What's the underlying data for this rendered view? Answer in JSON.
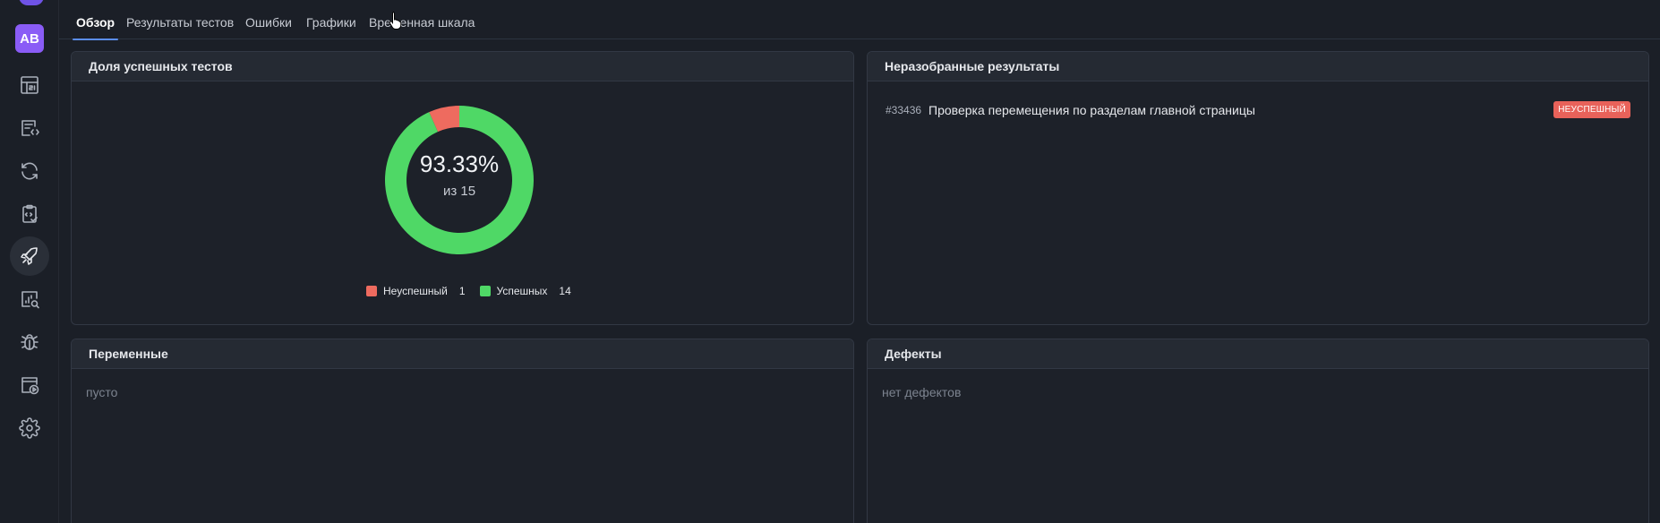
{
  "user": {
    "initials": "AB"
  },
  "sidebar": {
    "items": [
      {
        "icon": "dashboard-icon"
      },
      {
        "icon": "test-cases-icon"
      },
      {
        "icon": "sync-icon"
      },
      {
        "icon": "checklist-icon"
      },
      {
        "icon": "rocket-icon",
        "active": true
      },
      {
        "icon": "analytics-search-icon"
      },
      {
        "icon": "bug-icon"
      },
      {
        "icon": "play-icon"
      },
      {
        "icon": "gear-icon"
      }
    ]
  },
  "tabs": [
    {
      "label": "Обзор",
      "active": true
    },
    {
      "label": "Результаты тестов"
    },
    {
      "label": "Ошибки"
    },
    {
      "label": "Графики"
    },
    {
      "label": "Временная шкала"
    }
  ],
  "success_card": {
    "title": "Доля успешных тестов",
    "percent_text": "93.33%",
    "total_text": "из 15",
    "legend": [
      {
        "label": "Неуспешный",
        "count": "1",
        "color": "#ee6b5f"
      },
      {
        "label": "Успешных",
        "count": "14",
        "color": "#4fd866"
      }
    ]
  },
  "chart_data": {
    "type": "pie",
    "categories": [
      "Неуспешный",
      "Успешных"
    ],
    "values": [
      1,
      14
    ],
    "colors": [
      "#ee6b5f",
      "#4fd866"
    ],
    "center_label": "93.33%",
    "center_sublabel": "из 15",
    "legend_placement": "bottom"
  },
  "unprocessed_card": {
    "title": "Неразобранные результаты",
    "items": [
      {
        "id": "#33436",
        "name": "Проверка перемещения по разделам главной страницы",
        "status": "НЕУСПЕШНЫЙ"
      }
    ]
  },
  "variables_card": {
    "title": "Переменные",
    "empty_text": "пусто"
  },
  "defects_card": {
    "title": "Дефекты",
    "empty_text": "нет дефектов"
  },
  "colors": {
    "accent": "#5b8def",
    "failed": "#ee6b5f",
    "passed": "#4fd866",
    "avatar": "#8a5cf6"
  }
}
